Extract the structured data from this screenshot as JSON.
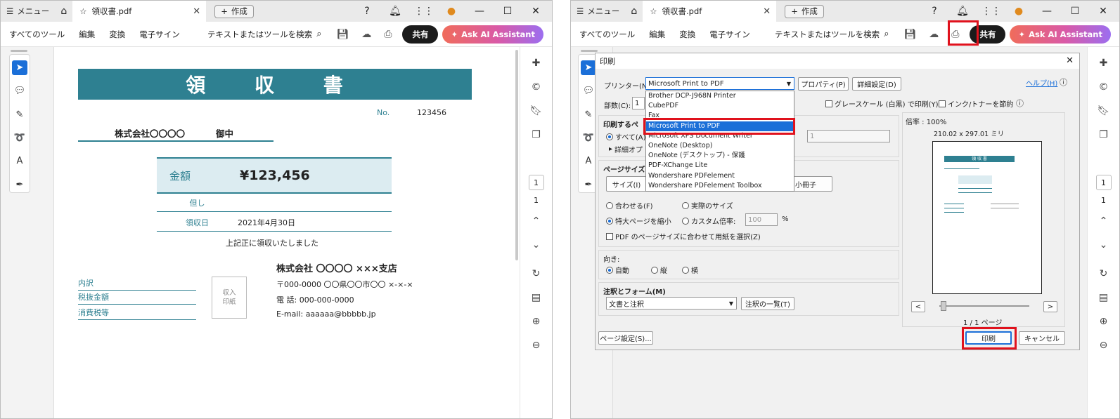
{
  "titlebar": {
    "menu": "メニュー",
    "tab_name": "領収書.pdf",
    "new_tab": "作成"
  },
  "toolbar": {
    "menus": [
      "すべてのツール",
      "編集",
      "変換",
      "電子サイン"
    ],
    "search_text": "テキストまたはツールを検索",
    "share": "共有",
    "ai": "Ask AI Assistant"
  },
  "sidebar_right": {
    "page_box": "1",
    "page_num": "1"
  },
  "receipt": {
    "title": "領 収 書",
    "no_label": "No.",
    "no_value": "123456",
    "company": "株式会社〇〇〇〇",
    "honorific": "御中",
    "amount_label": "金額",
    "amount": "¥123,456",
    "tadashi": "但し",
    "date_label": "領収日",
    "date": "2021年4月30日",
    "note": "上記正に領収いたしました",
    "breakdown": [
      "内訳",
      "税抜金額",
      "消費税等"
    ],
    "stamp": "収入\n印紙",
    "branch": "株式会社 〇〇〇〇 ×××支店",
    "address": "〒000-0000 〇〇県〇〇市〇〇 ×-×-×",
    "tel": "電 話: 000-000-0000",
    "email": "E-mail: aaaaaa@bbbbb.jp"
  },
  "print_dialog": {
    "title": "印刷",
    "printer_label": "プリンター(N):",
    "printer_value": "Microsoft Print to PDF",
    "properties": "プロパティ(P)",
    "advanced": "詳細設定(D)",
    "help": "ヘルプ(H)",
    "copies_label": "部数(C):",
    "copies": "1",
    "grayscale": "グレースケール (白黒) で印刷(Y)",
    "ink_save": "インク/トナーを節約",
    "printers": [
      "Brother DCP-J968N Printer",
      "CubePDF",
      "Fax",
      "Microsoft Print to PDF",
      "Microsoft XPS Document Writer",
      "OneNote (Desktop)",
      "OneNote (デスクトップ) - 保護",
      "PDF-XChange Lite",
      "Wondershare PDFelement",
      "Wondershare PDFelement Toolbox"
    ],
    "pages_title": "印刷するペ",
    "all_pages": "すべて(A)",
    "detail_options": "詳細オプ",
    "page_field": "1",
    "page_size_title": "ページサイズ",
    "size_btn": "サイズ(I)",
    "booklet": "小冊子",
    "fit": "合わせる(F)",
    "actual": "実際のサイズ",
    "shrink": "特大ページを縮小",
    "custom_scale": "カスタム倍率:",
    "scale_value": "100",
    "percent": "%",
    "choose_paper": "PDF のページサイズに合わせて用紙を選択(Z)",
    "orientation_title": "向き:",
    "auto": "自動",
    "portrait": "縦",
    "landscape": "横",
    "annot_title": "注釈とフォーム(M)",
    "annot_value": "文書と注釈",
    "annot_list": "注釈の一覧(T)",
    "zoom": "倍率 : 100%",
    "paper_size": "210.02 x 297.01 ミリ",
    "page_count": "1 / 1 ページ",
    "page_setup": "ページ設定(S)...",
    "print": "印刷",
    "cancel": "キャンセル",
    "mini_title": "領 収 書"
  }
}
